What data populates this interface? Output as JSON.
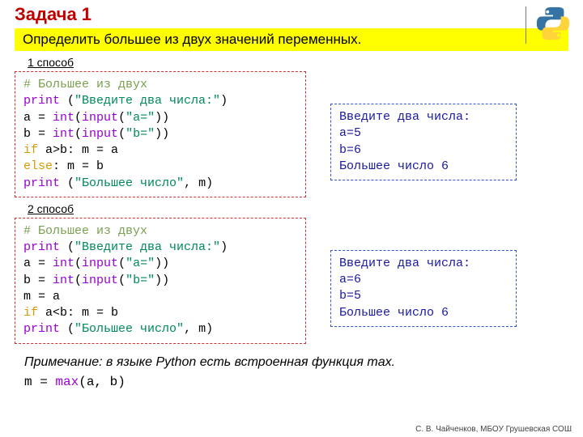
{
  "title": "Задача 1",
  "subtitle": "Определить большее из двух значений переменных.",
  "method1_label": "1 способ",
  "method2_label": "2 способ",
  "code1": {
    "l1": "# Большее из двух",
    "l2a": "print",
    "l2b": " (",
    "l2c": "\"Введите два числа:\"",
    "l2d": ")",
    "l3a": "a = ",
    "l3b": "int",
    "l3c": "(",
    "l3d": "input",
    "l3e": "(",
    "l3f": "\"a=\"",
    "l3g": "))",
    "l4a": "b = ",
    "l4b": "int",
    "l4c": "(",
    "l4d": "input",
    "l4e": "(",
    "l4f": "\"b=\"",
    "l4g": "))",
    "l5a": "if",
    "l5b": " a>b: m = a",
    "l6a": "else",
    "l6b": ": m = b",
    "l7a": "print",
    "l7b": " (",
    "l7c": "\"Большее число\"",
    "l7d": ", m)"
  },
  "output1": "Введите два числа:\na=5\nb=6\nБольшее число 6",
  "code2": {
    "l1": "# Большее из двух",
    "l2a": "print",
    "l2b": " (",
    "l2c": "\"Введите два числа:\"",
    "l2d": ")",
    "l3a": "a = ",
    "l3b": "int",
    "l3c": "(",
    "l3d": "input",
    "l3e": "(",
    "l3f": "\"a=\"",
    "l3g": "))",
    "l4a": "b = ",
    "l4b": "int",
    "l4c": "(",
    "l4d": "input",
    "l4e": "(",
    "l4f": "\"b=\"",
    "l4g": "))",
    "l5": "m = a",
    "l6a": "if",
    "l6b": " a<b: m = b",
    "l7a": "print",
    "l7b": " (",
    "l7c": "\"Большее число\"",
    "l7d": ", m)"
  },
  "output2": "Введите два числа:\na=6\nb=5\nБольшее число 6",
  "note": "Примечание: в языке Python есть встроенная функция max.",
  "note_code_a": "m = ",
  "note_code_b": "max",
  "note_code_c": "(a, b)",
  "footer": "С. В. Чайченков, МБОУ Грушевская СОШ"
}
